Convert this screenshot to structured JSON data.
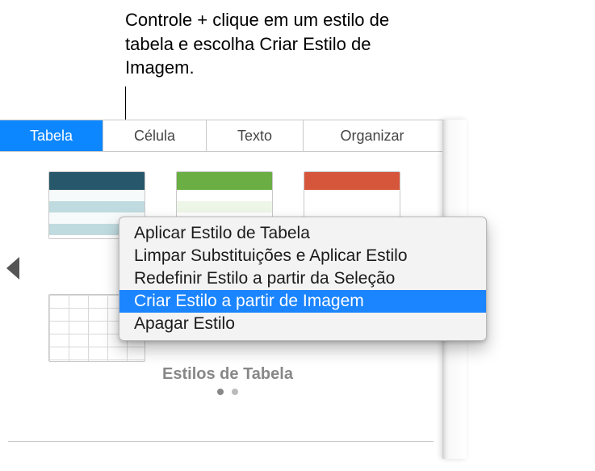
{
  "callout": "Controle + clique em um estilo de tabela e escolha Criar Estilo de Imagem.",
  "tabs": {
    "table": "Tabela",
    "cell": "Célula",
    "text": "Texto",
    "organize": "Organizar"
  },
  "section_label": "Estilos de Tabela",
  "thumbs": {
    "dark": "table-style-dark-header",
    "green": "table-style-green-header",
    "red": "table-style-red-header",
    "grid": "table-style-grid"
  },
  "menu": {
    "apply": "Aplicar Estilo de Tabela",
    "clear": "Limpar Substituições e Aplicar Estilo",
    "redefine": "Redefinir Estilo a partir da Seleção",
    "create": "Criar Estilo a partir de Imagem",
    "delete": "Apagar Estilo"
  }
}
